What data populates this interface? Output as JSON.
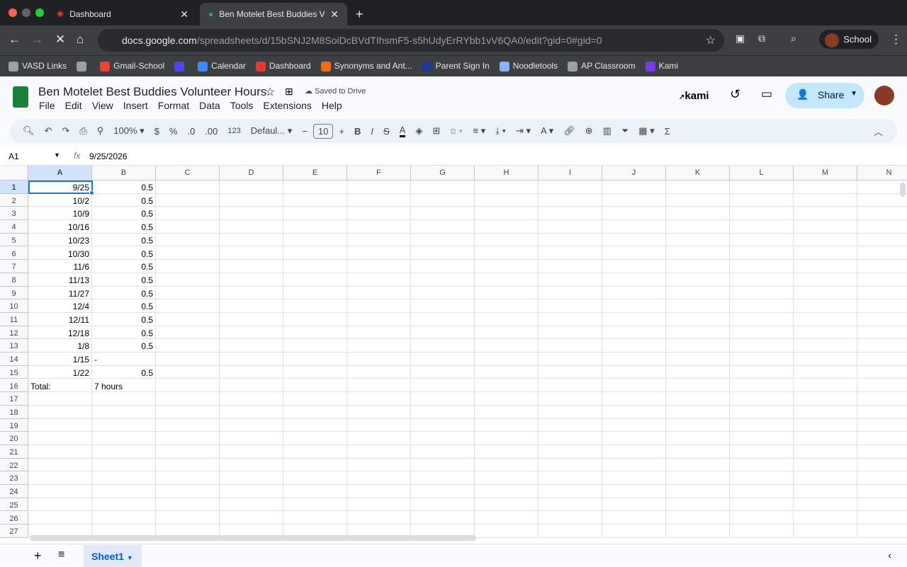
{
  "browser": {
    "tabs": [
      {
        "label": "Dashboard"
      },
      {
        "label": "Ben Motelet Best Buddies Vol"
      }
    ],
    "url_host": "docs.google.com",
    "url_path": "/spreadsheets/d/15bSNJ2M8SoiDcBVdTIhsmF5-s5hUdyErRYbb1vV6QA0/edit?gid=0#gid=0",
    "profile": "School",
    "bookmarks": [
      {
        "label": "VASD Links",
        "color": "#9aa0a6"
      },
      {
        "label": "",
        "color": "#9aa0a6"
      },
      {
        "label": "Gmail-School",
        "color": "#ea4335"
      },
      {
        "label": "",
        "color": "#4f46e5"
      },
      {
        "label": "Calendar",
        "color": "#4285f4"
      },
      {
        "label": "Dashboard",
        "color": "#e03c31"
      },
      {
        "label": "Synonyms and Ant...",
        "color": "#f26b1d"
      },
      {
        "label": "Parent Sign In",
        "color": "#1e3a8a"
      },
      {
        "label": "Noodletools",
        "color": "#8ab4f8"
      },
      {
        "label": "AP Classroom",
        "color": "#9aa0a6"
      },
      {
        "label": "Kami",
        "color": "#7c3aed"
      }
    ]
  },
  "doc": {
    "title": "Ben Motelet Best Buddies Volunteer Hours",
    "saved": "Saved to Drive",
    "kami": "kami",
    "share": "Share",
    "menu": [
      "File",
      "Edit",
      "View",
      "Insert",
      "Format",
      "Data",
      "Tools",
      "Extensions",
      "Help"
    ]
  },
  "toolbar": {
    "zoom": "100%",
    "currency": "$",
    "percent": "%",
    "dec_less": ".0",
    "dec_more": ".00",
    "format": "123",
    "font": "Defaul...",
    "font_size": "10",
    "bold": "B",
    "italic": "I"
  },
  "formula": {
    "cell_ref": "A1",
    "fx": "fx",
    "value": "9/25/2026"
  },
  "columns": [
    "A",
    "B",
    "C",
    "D",
    "E",
    "F",
    "G",
    "H",
    "I",
    "J",
    "K",
    "L",
    "M",
    "N"
  ],
  "rows": [
    [
      "9/25",
      "0.5"
    ],
    [
      "10/2",
      "0.5"
    ],
    [
      "10/9",
      "0.5"
    ],
    [
      "10/16",
      "0.5"
    ],
    [
      "10/23",
      "0.5"
    ],
    [
      "10/30",
      "0.5"
    ],
    [
      "11/6",
      "0.5"
    ],
    [
      "11/13",
      "0.5"
    ],
    [
      "11/27",
      "0.5"
    ],
    [
      "12/4",
      "0.5"
    ],
    [
      "12/11",
      "0.5"
    ],
    [
      "12/18",
      "0.5"
    ],
    [
      "1/8",
      "0.5"
    ],
    [
      "1/15",
      "-"
    ],
    [
      "1/22",
      "0.5"
    ],
    [
      "Total:",
      "7 hours"
    ]
  ],
  "row_count": 27,
  "sheets": [
    {
      "label": "Sheet1"
    }
  ]
}
